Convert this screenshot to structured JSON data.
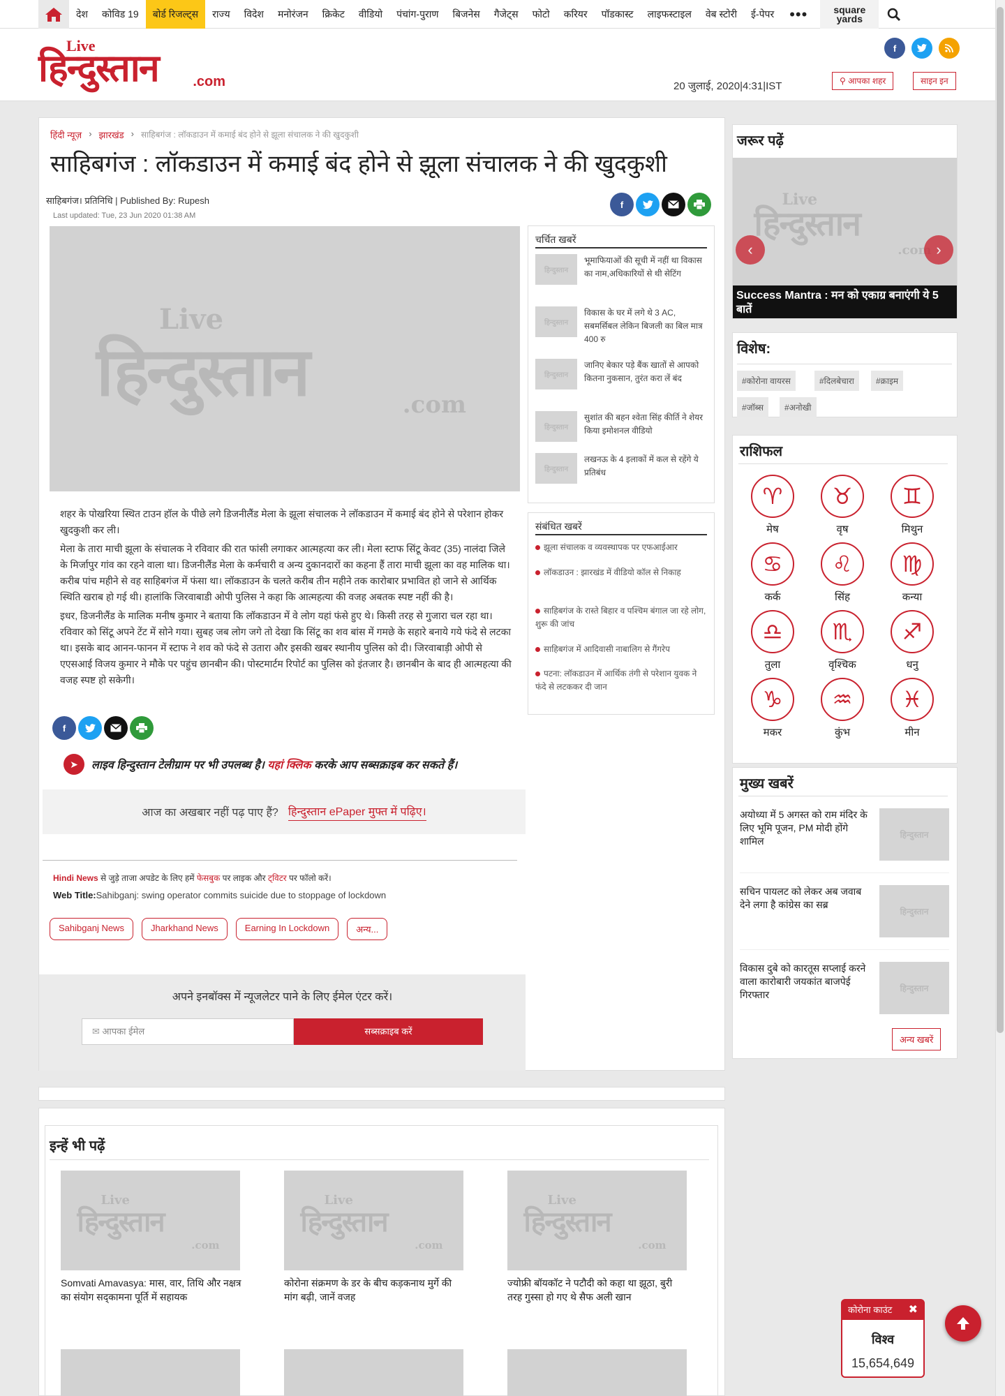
{
  "nav": {
    "items": [
      "देश",
      "कोविड 19",
      "बोर्ड रिजल्ट्स",
      "राज्य",
      "विदेश",
      "मनोरंजन",
      "क्रिकेट",
      "वीडियो",
      "पंचांग-पुराण",
      "बिजनेस",
      "गैजेट्स",
      "फोटो",
      "करियर",
      "पॉडकास्ट",
      "लाइफस्टाइल",
      "वेब स्टोरी",
      "ई-पेपर"
    ],
    "active_item": "बोर्ड रिजल्ट्स",
    "more": "•••",
    "partner_line1": "square",
    "partner_line2": "yards"
  },
  "header": {
    "logo_live": "Live",
    "logo_hindi": "हिन्दुस्तान",
    "logo_com": ".com",
    "date": "20 जुलाई, 2020|4:31|IST",
    "city_btn": "आपका शहर",
    "signin_btn": "साइन इन"
  },
  "article": {
    "breadcrumb": [
      "हिंदी न्यूज़",
      "झारखंड",
      "साहिबगंज : लॉकडाउन में कमाई बंद होने से झूला संचालक ने की खुदकुशी"
    ],
    "headline": "साहिबगंज : लॉकडाउन में कमाई बंद होने से झूला संचालक ने की खुदकुशी",
    "byline": "साहिबगंज। प्रतिनिधि     | Published By: Rupesh",
    "updated": "Last updated:  Tue, 23 Jun 2020 01:38 AM",
    "paragraphs": [
      "शहर के पोखरिया स्थित टाउन हॉल के पीछे लगे डिजनीलैंड मेला के झूला संचालक ने लॉकडाउन में कमाई बंद होने से परेशान होकर खुदकुशी कर ली।",
      "मेला के तारा माची झूला के संचालक ने रविवार की रात फांसी लगाकर आत्महत्या कर ली। मेला स्टाफ सिंटू केवट (35) नालंदा जिले के मिर्जापुर गांव का रहने वाला था। डिजनीलैंड मेला के कर्मचारी व अन्य दुकानदारों का कहना हैं तारा माची झूला का वह मालिक था। करीब पांच महीने से वह साहिबगंज में फंसा था। लॉकडाउन के चलते करीब तीन महीने तक कारोबार प्रभावित हो जाने से आर्थिक स्थिति खराब हो गई थी। हालांकि जिरवाबाडी ओपी पुलिस ने कहा कि आत्महत्या की वजह अबतक स्पष्ट नहीं की है।",
      "इधर, डिजनीलैंड के मालिक मनीष कुमार ने बताया कि लॉकडाउन में वे लोग यहां फंसे हुए थे। किसी तरह से गुजारा चल रहा था। रविवार को सिंटू अपने टेंट में सोने गया। सुबह जब लोग जगे तो देखा कि सिंटू का शव बांस में गमछे के सहारे बनाये गये फंदे से लटका था। इसके बाद आनन-फानन में स्टाफ ने शव को फंदे से उतारा और इसकी खबर स्थानीय पुलिस को दी। जिरवाबाड़ी ओपी से एएसआई विजय कुमार ने मौके पर पहुंच छानबीन की। पोस्टमार्टम रिपोर्ट का पुलिस को इंतजार है। छानबीन के बाद ही आत्महत्या की वजह स्पष्ट हो सकेगी।"
    ],
    "telegram_a": "लाइव हिन्दुस्तान टेलीग्राम पर भी उपलब्ध है। ",
    "telegram_link": "यहां क्लिक",
    "telegram_b": " करके आप सब्सक्राइब कर सकते हैं।",
    "epaper_q": "आज का अखबार नहीं पढ़ पाए हैं?",
    "epaper_link": "हिन्दुस्तान ePaper मुफ्त में पढ़िए।",
    "follow_a": "Hindi News",
    "follow_b": " से जुड़े ताजा अपडेट के लिए हमें ",
    "follow_fb": "फेसबुक",
    "follow_c": " पर लाइक और ",
    "follow_tw": "ट्विटर",
    "follow_d": " पर फॉलो करें।",
    "webtitle_label": "Web Title:",
    "webtitle": "Sahibganj: swing operator commits suicide due to stoppage of lockdown",
    "tags": [
      "Sahibganj News",
      "Jharkhand News",
      "Earning In Lockdown",
      "अन्य..."
    ]
  },
  "newsletter": {
    "title": "अपने इनबॉक्स में न्यूजलेटर पाने के लिए ईमेल एंटर करें।",
    "placeholder": "आपका ईमेल",
    "button": "सब्सक्राइब करें"
  },
  "charchit": {
    "title": "चर्चित खबरें",
    "items": [
      "भूमाफियाओं की सूची में नहीं था विकास का नाम,अधिकारियों से थी सेटिंग",
      "विकास के घर में लगे थे 3 AC, सबमर्सिबल लेकिन बिजली का बिल मात्र 400 रु",
      "जानिए बेकार पड़े बैंक खातों से आपको कितना नुकसान, तुरंत करा लें बंद",
      "सुशांत की बहन श्वेता सिंह कीर्ति ने शेयर किया इमोशनल वीडियो",
      "लखनऊ के 4 इलाकों में कल से रहेंगे ये प्रतिबंध"
    ]
  },
  "sambandhit": {
    "title": "संबंधित खबरें",
    "items": [
      "झूला संचालक व व्यवस्थापक पर एफआईआर",
      "लॉकडाउन : झारखंड में वीडियो कॉल से निकाह",
      "साहिबगंज के रास्ते बिहार व पश्चिम बंगाल जा रहे लोग, शुरू की जांच",
      "साहिबगंज में आदिवासी नाबालिग से गैंगरेप",
      "पटना: लॉकडाउन में आर्थिक तंगी से परेशान युवक ने फंदे से लटककर दी जान"
    ]
  },
  "sidebar": {
    "zarur_title": "जरूर पढ़ें",
    "zarur_caption": "Success Mantra : मन को एकाग्र बनाएंगी ये 5 बातें",
    "vishesh_title": "विशेष:",
    "vishesh_tags": [
      "#कोरोना वायरस",
      "#दिलबेचारा",
      "#क्राइम",
      "#जॉब्स",
      "#अनोखी"
    ],
    "rashi_title": "राशिफल",
    "rashi": [
      {
        "name": "मेष",
        "glyph": "♈"
      },
      {
        "name": "वृष",
        "glyph": "♉"
      },
      {
        "name": "मिथुन",
        "glyph": "♊"
      },
      {
        "name": "कर्क",
        "glyph": "♋"
      },
      {
        "name": "सिंह",
        "glyph": "♌"
      },
      {
        "name": "कन्या",
        "glyph": "♍"
      },
      {
        "name": "तुला",
        "glyph": "♎"
      },
      {
        "name": "वृश्चिक",
        "glyph": "♏"
      },
      {
        "name": "धनु",
        "glyph": "♐"
      },
      {
        "name": "मकर",
        "glyph": "♑"
      },
      {
        "name": "कुंभ",
        "glyph": "♒"
      },
      {
        "name": "मीन",
        "glyph": "♓"
      }
    ],
    "mukhya_title": "मुख्य खबरें",
    "mukhya": [
      "अयोध्या में 5 अगस्त को राम मंदिर के लिए भूमि पूजन, PM मोदी होंगे शामिल",
      "सचिन पायलट को लेकर अब जवाब देने लगा है कांग्रेस का सब्र",
      "विकास दुबे को कारतूस सप्लाई करने वाला कारोबारी जयकांत बाजपेई गिरफ्तार"
    ],
    "more_btn": "अन्य खबरें"
  },
  "readalso": {
    "title": "इन्हें भी पढ़ें",
    "items": [
      "Somvati Amavasya: मास, वार, तिथि और नक्षत्र का संयोग सद्कामना पूर्ति में सहायक",
      "कोरोना संक्रमण के डर के बीच कड़कनाथ मुर्गे की मांग बढ़ी, जानें वजह",
      "ज्योफ्री बॉयकॉट ने पटौदी को कहा था झूठा, बुरी तरह गुस्सा हो गए थे सैफ अली खान"
    ]
  },
  "corona": {
    "title": "कोरोना काउंट",
    "close": "✖",
    "region": "विश्व",
    "count": "15,654,649"
  },
  "placeholder": {
    "live": "Live",
    "hindi": "हिन्दुस्तान",
    "com": ".com"
  },
  "colors": {
    "brand_red": "#c9212e",
    "nav_highlight": "#fcc717",
    "facebook": "#3b5998",
    "twitter": "#1da1f2",
    "rss": "#f4a200",
    "print": "#2f9a3a"
  }
}
